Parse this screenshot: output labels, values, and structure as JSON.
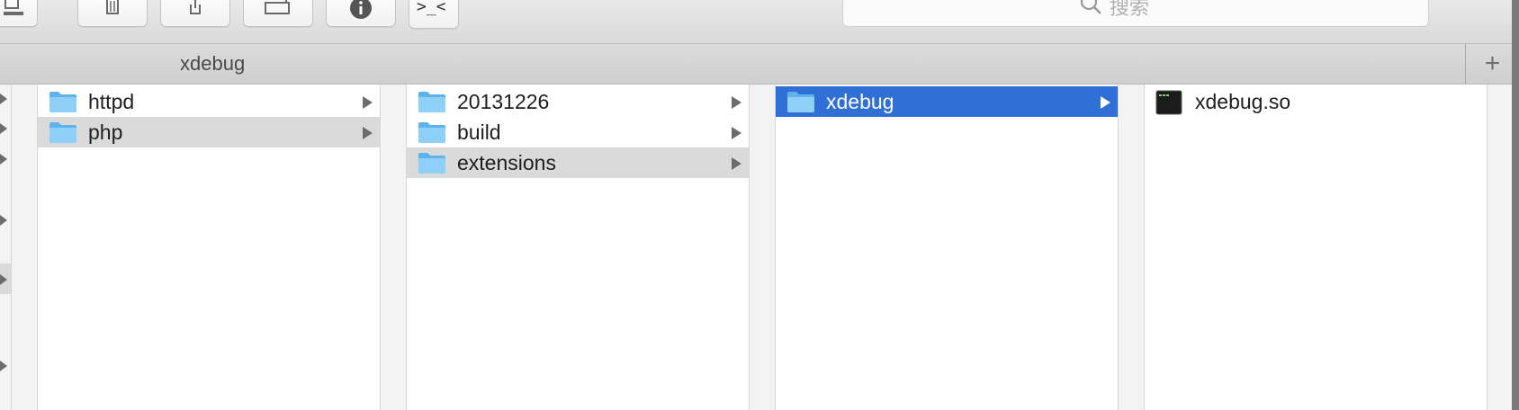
{
  "toolbar": {
    "buttons": [
      {
        "name": "connect-server-icon"
      },
      {
        "name": "trash-icon"
      },
      {
        "name": "share-icon"
      },
      {
        "name": "new-folder-icon"
      },
      {
        "name": "info-icon"
      },
      {
        "name": "terminal-icon",
        "glyph": ">_<"
      }
    ],
    "search_placeholder": "搜索"
  },
  "tab": {
    "title": "xdebug",
    "add_label": "+"
  },
  "columns": [
    {
      "items": [
        {
          "label": "httpd",
          "icon": "folder-icon",
          "state": "normal"
        },
        {
          "label": "php",
          "icon": "folder-icon",
          "state": "selected-inactive"
        }
      ]
    },
    {
      "items": [
        {
          "label": "20131226",
          "icon": "folder-icon",
          "state": "normal"
        },
        {
          "label": "build",
          "icon": "folder-icon",
          "state": "normal"
        },
        {
          "label": "extensions",
          "icon": "folder-icon",
          "state": "selected-inactive"
        }
      ]
    },
    {
      "items": [
        {
          "label": "xdebug",
          "icon": "folder-icon",
          "state": "selected-active"
        }
      ]
    },
    {
      "items": [
        {
          "label": "xdebug.so",
          "icon": "executable-file-icon",
          "state": "normal"
        }
      ]
    }
  ],
  "colors": {
    "selection_active": "#2f6fd6",
    "selection_inactive": "#dadada",
    "folder": "#7cc6f5"
  }
}
